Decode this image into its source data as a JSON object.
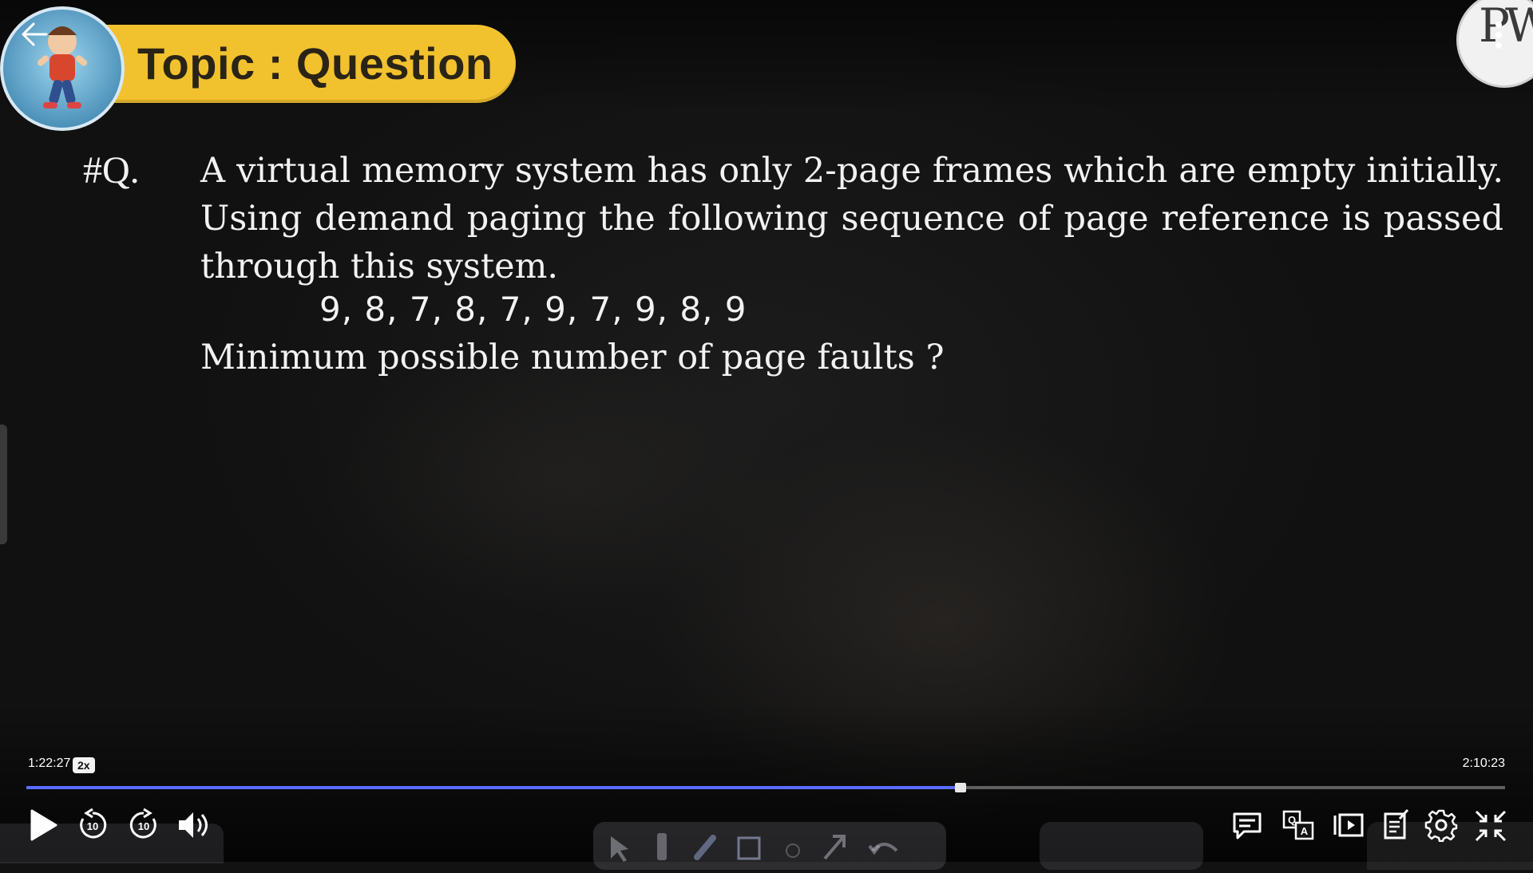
{
  "header": {
    "topic": "Topic : Question",
    "logo_text": "PW"
  },
  "question": {
    "number": "#Q.",
    "body": "A virtual memory system has only 2-page frames which are empty initially. Using demand paging the following sequence of page reference is passed through this system.",
    "sequence": "9, 8, 7, 8, 7, 9, 7, 9, 8, 9",
    "prompt": "Minimum possible  number of page faults ?"
  },
  "player": {
    "current_time": "1:22:27",
    "speed": "2x",
    "total_time": "2:10:23",
    "progress_fraction": 0.632,
    "accent_color": "#5b6cff",
    "rewind_seconds": "10",
    "forward_seconds": "10"
  },
  "icons": {
    "back": "arrow-left-icon",
    "menu": "kebab-menu-icon",
    "play": "play-icon",
    "rewind": "rewind-10-icon",
    "forward": "forward-10-icon",
    "volume": "volume-icon",
    "chat": "chat-icon",
    "translate": "translate-icon",
    "playlist": "playlist-icon",
    "notes": "notes-icon",
    "settings": "gear-icon",
    "exit_fullscreen": "exit-fullscreen-icon"
  }
}
